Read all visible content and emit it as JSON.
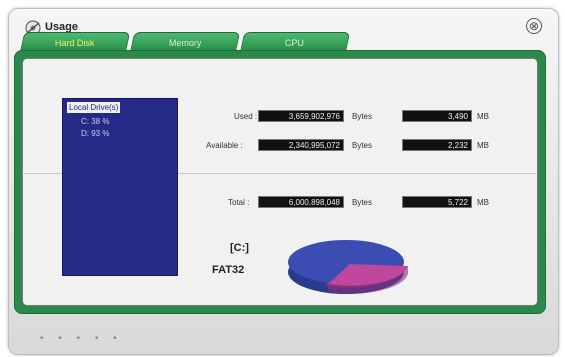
{
  "window": {
    "title": "Usage"
  },
  "tabs": [
    {
      "label": "Hard Disk",
      "active": true
    },
    {
      "label": "Memory",
      "active": false
    },
    {
      "label": "CPU",
      "active": false
    }
  ],
  "drives": {
    "header": "Local Drive(s)",
    "items": [
      "C:  38 %",
      "D:  93 %"
    ]
  },
  "usage": {
    "used_label": "Used :",
    "used_bytes": "3,659,902,976",
    "used_mb": "3,490",
    "available_label": "Available :",
    "available_bytes": "2,340,995,072",
    "available_mb": "2,232",
    "total_label": "Total :",
    "total_bytes": "6,000,898,048",
    "total_mb": "5,722",
    "bytes_unit": "Bytes",
    "mb_unit": "MB"
  },
  "drive_info": {
    "letter": "[C:]",
    "filesystem": "FAT32"
  },
  "pie": {
    "used_fraction": 0.61,
    "used_color": "#3b4db3",
    "free_color": "#c0479e"
  },
  "colors": {
    "accent_green": "#2b8a4a",
    "drive_list_bg": "#252a88"
  }
}
